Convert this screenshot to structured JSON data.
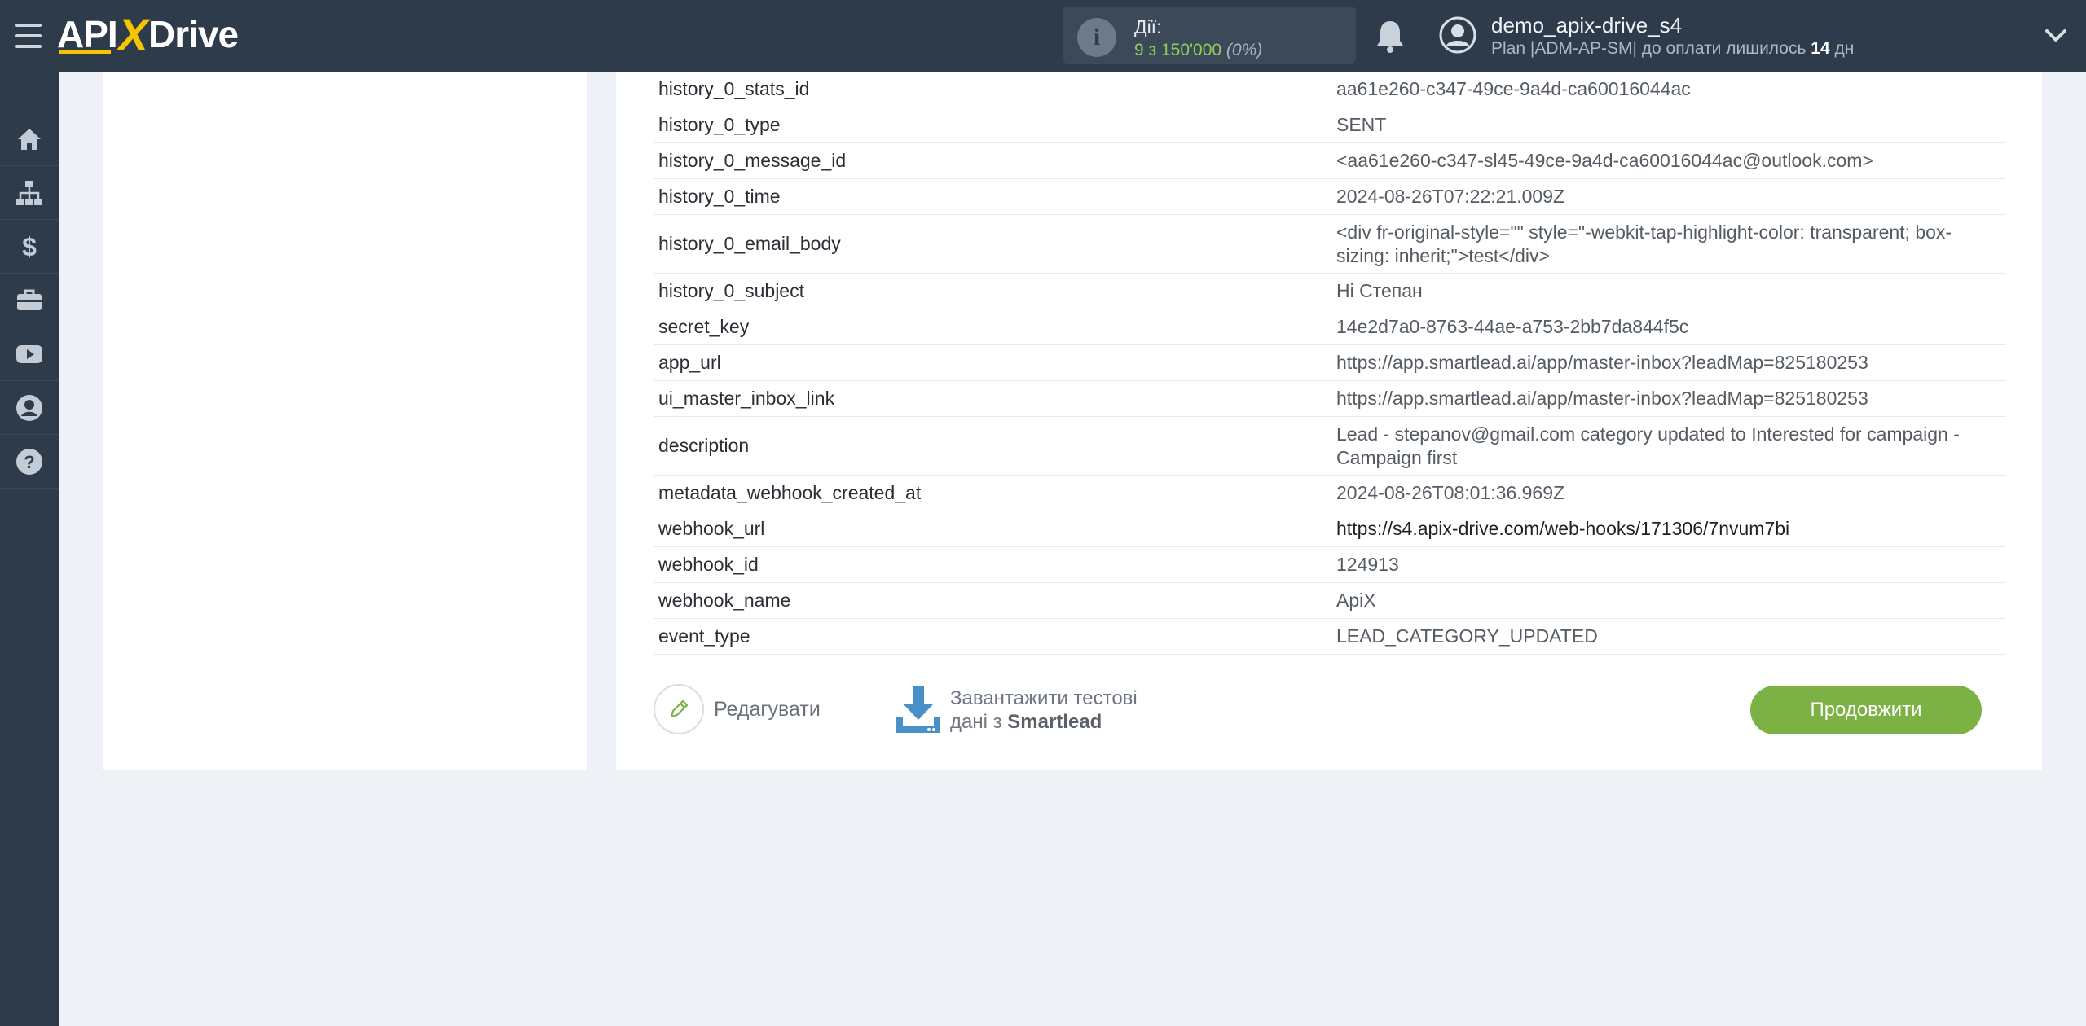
{
  "header": {
    "logo": {
      "api": "API",
      "x": "X",
      "drive": "Drive"
    },
    "actions": {
      "label": "Дії:",
      "count": "9 з 150'000",
      "percent": "(0%)"
    },
    "user": {
      "name": "demo_apix-drive_s4",
      "plan_prefix": "Plan |ADM-AP-SM| до оплати лишилось ",
      "days": "14",
      "days_suffix": " дн"
    }
  },
  "sidebar": {
    "items": [
      {
        "icon": "home-icon"
      },
      {
        "icon": "sitemap-icon"
      },
      {
        "icon": "dollar-icon"
      },
      {
        "icon": "briefcase-icon"
      },
      {
        "icon": "youtube-icon"
      },
      {
        "icon": "user-circle-icon"
      },
      {
        "icon": "help-icon"
      }
    ]
  },
  "table": {
    "rows": [
      {
        "key": "history_0_stats_id",
        "value": "aa61e260-c347-49ce-9a4d-ca60016044ac"
      },
      {
        "key": "history_0_type",
        "value": "SENT"
      },
      {
        "key": "history_0_message_id",
        "value": "<aa61e260-c347-sl45-49ce-9a4d-ca60016044ac@outlook.com>"
      },
      {
        "key": "history_0_time",
        "value": "2024-08-26T07:22:21.009Z"
      },
      {
        "key": "history_0_email_body",
        "value": "<div fr-original-style=\"\" style=\"-webkit-tap-highlight-color: transparent; box-sizing: inherit;\">test</div>"
      },
      {
        "key": "history_0_subject",
        "value": "Hi Степан"
      },
      {
        "key": "secret_key",
        "value": "14e2d7a0-8763-44ae-a753-2bb7da844f5c"
      },
      {
        "key": "app_url",
        "value": "https://app.smartlead.ai/app/master-inbox?leadMap=825180253"
      },
      {
        "key": "ui_master_inbox_link",
        "value": "https://app.smartlead.ai/app/master-inbox?leadMap=825180253"
      },
      {
        "key": "description",
        "value": "Lead - stepanov@gmail.com category updated to Interested for campaign - Campaign first"
      },
      {
        "key": "metadata_webhook_created_at",
        "value": "2024-08-26T08:01:36.969Z"
      },
      {
        "key": "webhook_url",
        "value": "https://s4.apix-drive.com/web-hooks/171306/7nvum7bi"
      },
      {
        "key": "webhook_id",
        "value": "124913"
      },
      {
        "key": "webhook_name",
        "value": "ApiX"
      },
      {
        "key": "event_type",
        "value": "LEAD_CATEGORY_UPDATED"
      }
    ]
  },
  "footer": {
    "edit_label": "Редагувати",
    "load_line1": "Завантажити тестові",
    "load_line2_prefix": "дані з ",
    "load_source": "Smartlead",
    "continue_label": "Продовжити"
  },
  "colors": {
    "topbar": "#2d3b4b",
    "accent_green": "#7bb243",
    "logo_yellow": "#f6c400",
    "page_bg": "#eef1f6"
  }
}
